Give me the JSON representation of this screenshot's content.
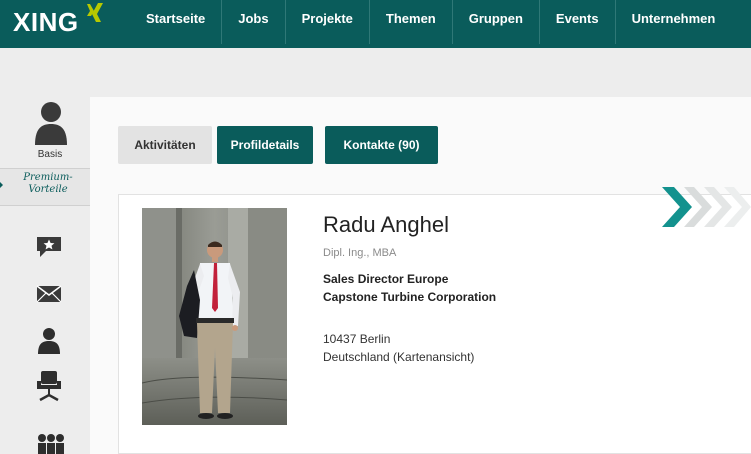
{
  "brand": {
    "logo_text": "XING"
  },
  "nav": {
    "items": [
      {
        "label": "Startseite"
      },
      {
        "label": "Jobs"
      },
      {
        "label": "Projekte"
      },
      {
        "label": "Themen"
      },
      {
        "label": "Gruppen"
      },
      {
        "label": "Events"
      },
      {
        "label": "Unternehmen"
      }
    ]
  },
  "sidebar": {
    "membership_label": "Basis",
    "premium_line1": "Premium-",
    "premium_line2": "Vorteile",
    "icons": [
      "star-message-icon",
      "mail-icon",
      "contact-person-icon",
      "office-chair-icon",
      "group-icon"
    ]
  },
  "tabs": {
    "activities": "Aktivitäten",
    "profile_details": "Profildetails",
    "contacts": "Kontakte (90)"
  },
  "profile": {
    "name": "Radu Anghel",
    "degree": "Dipl. Ing., MBA",
    "position": "Sales Director Europe",
    "company": "Capstone Turbine Corporation",
    "postal_city": "10437 Berlin",
    "country_map": "Deutschland (Kartenansicht)"
  },
  "colors": {
    "brand_teal": "#0a5c5b",
    "logo_green": "#b7c900",
    "page_bg": "#ededed"
  }
}
